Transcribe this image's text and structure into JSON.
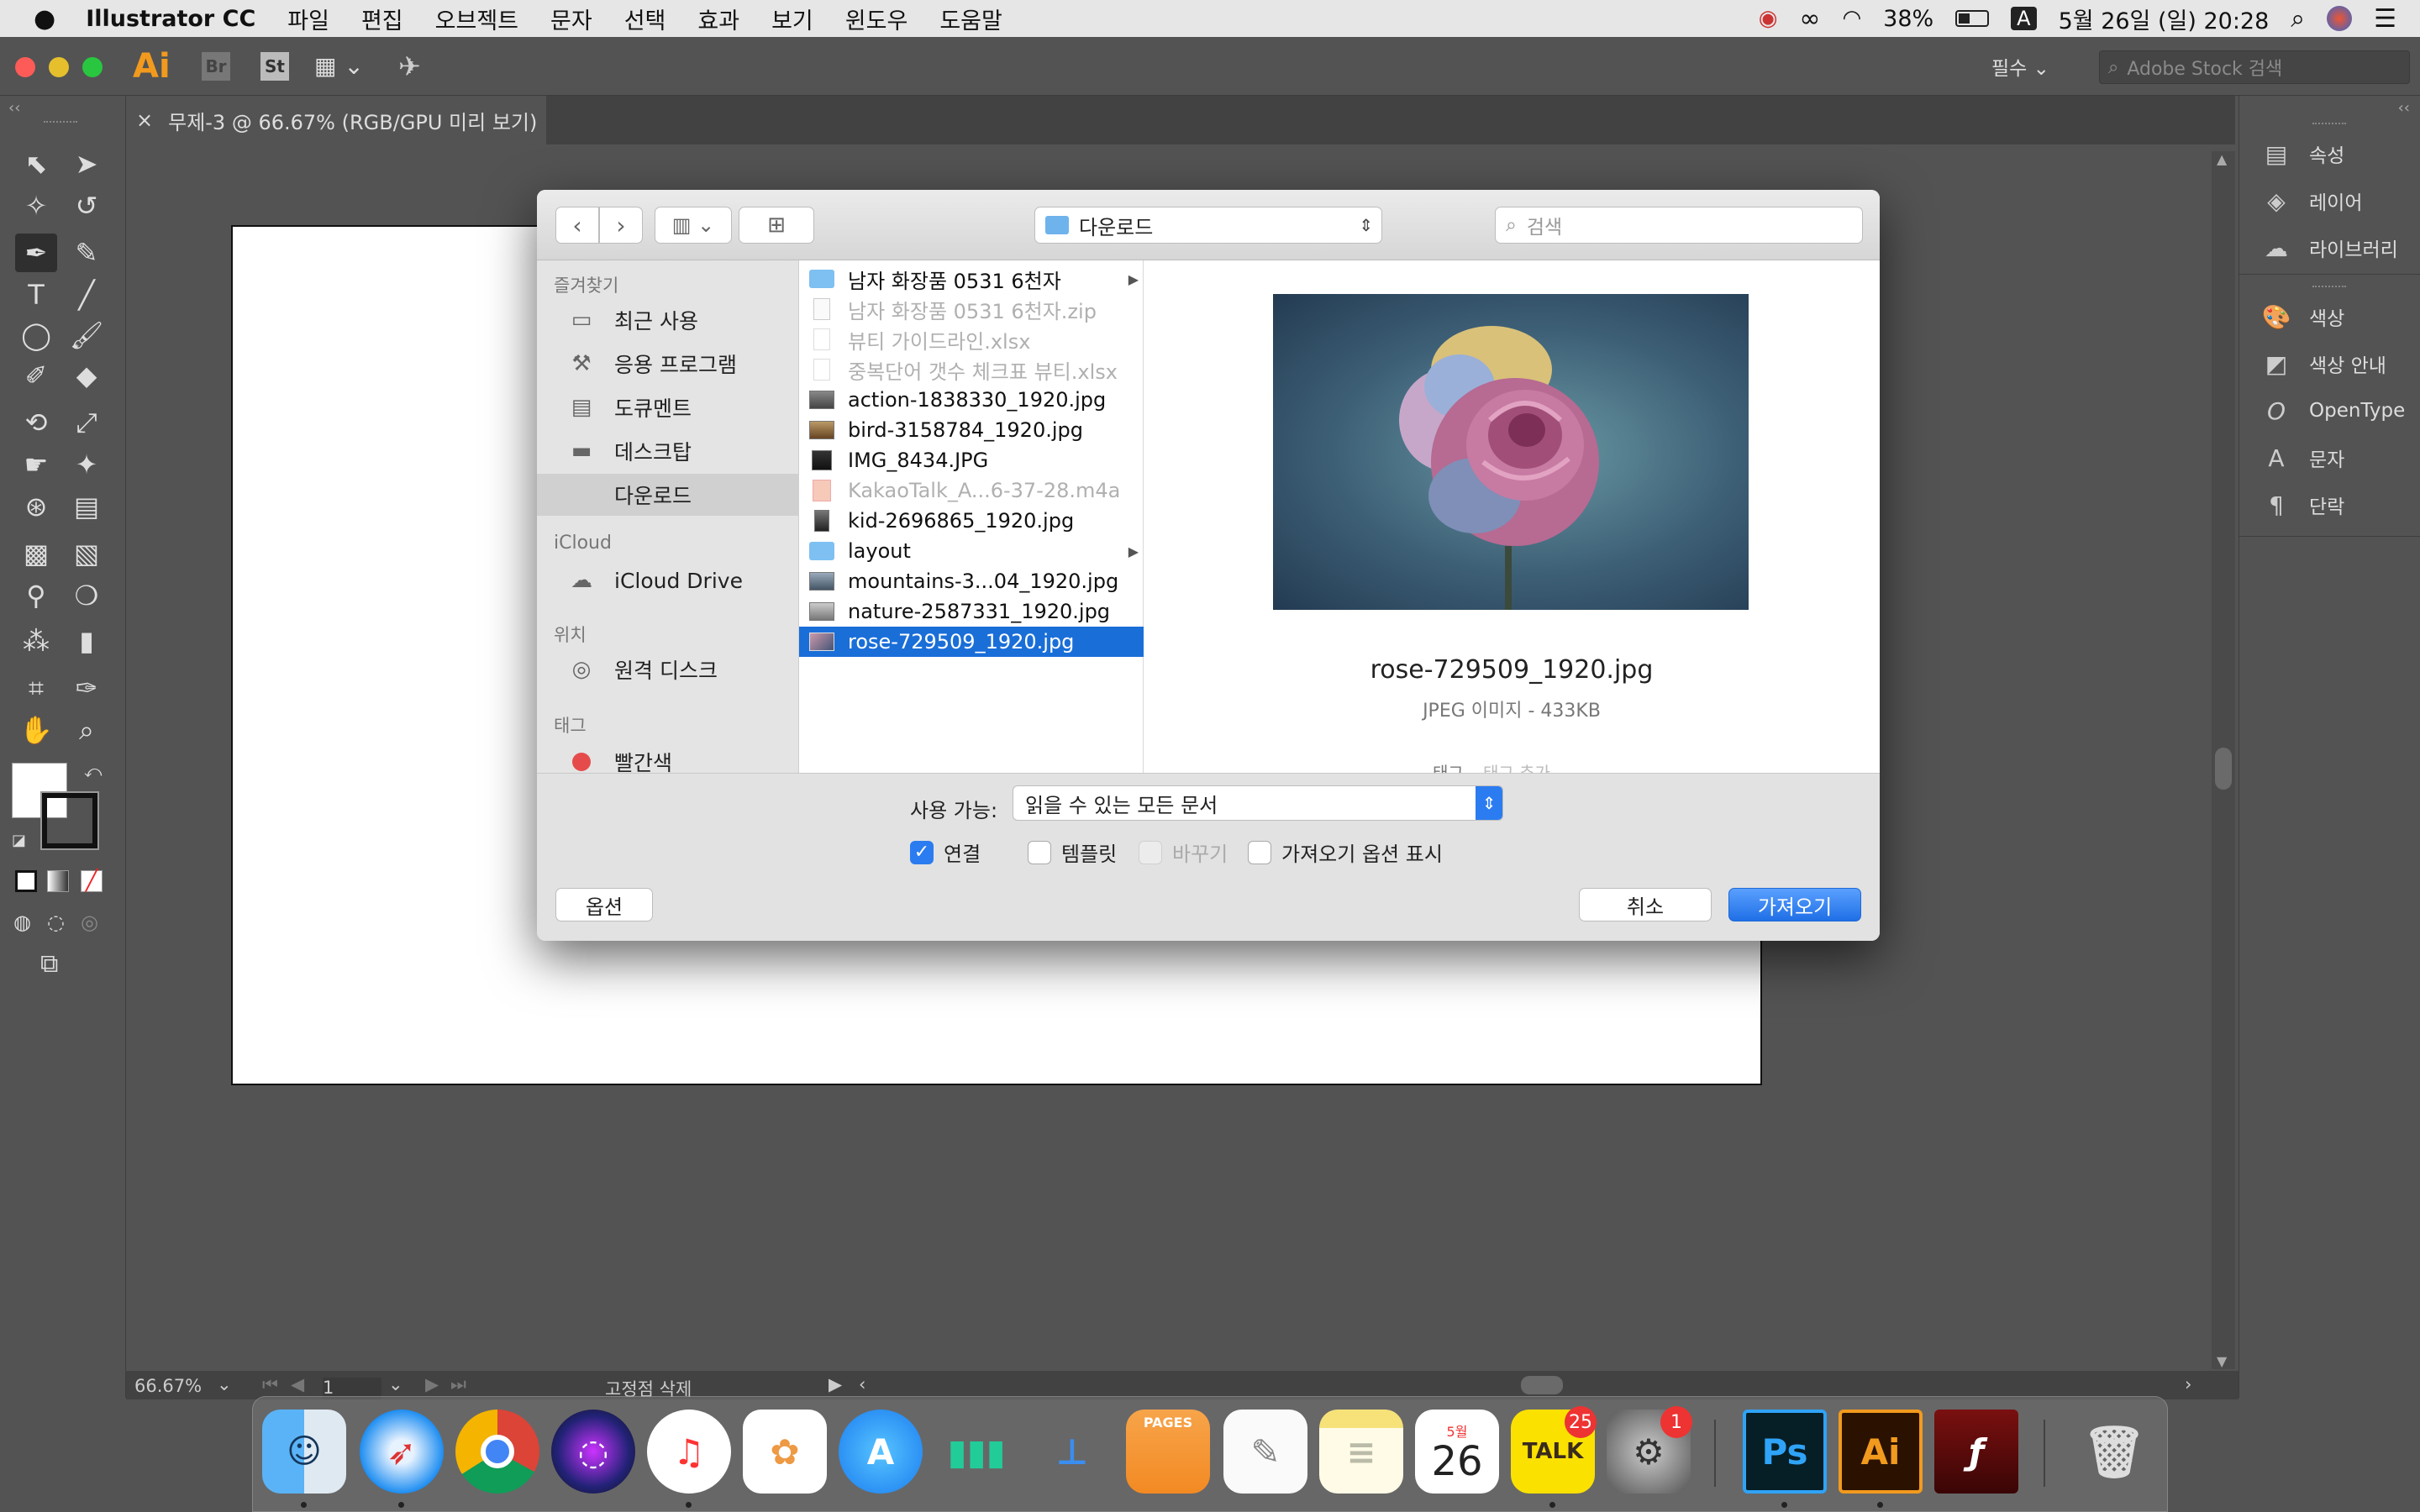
{
  "menubar": {
    "app": "Illustrator CC",
    "items": [
      "파일",
      "편집",
      "오브젝트",
      "문자",
      "선택",
      "효과",
      "보기",
      "윈도우",
      "도움말"
    ],
    "battery": "38%",
    "input_method": "A",
    "clock": "5월 26일 (일)  20:28"
  },
  "appbar": {
    "ai": "Ai",
    "br": "Br",
    "st": "St",
    "workspace": "필수",
    "stock_placeholder": "Adobe Stock 검색"
  },
  "document_tab": {
    "close": "×",
    "title": "무제-3 @ 66.67% (RGB/GPU 미리 보기)"
  },
  "right_panel": {
    "items": [
      "속성",
      "레이어",
      "라이브러리",
      "색상",
      "색상 안내",
      "OpenType",
      "문자",
      "단락"
    ]
  },
  "status": {
    "zoom": "66.67%",
    "page": "1",
    "tool": "고정점 삭제"
  },
  "dialog": {
    "location": "다운로드",
    "search_placeholder": "검색",
    "sidebar": {
      "favorites_header": "즐겨찾기",
      "favorites": [
        "최근 사용",
        "응용 프로그램",
        "도큐멘트",
        "데스크탑",
        "다운로드"
      ],
      "icloud_header": "iCloud",
      "icloud": [
        "iCloud Drive"
      ],
      "locations_header": "위치",
      "locations": [
        "원격 디스크"
      ],
      "tags_header": "태그",
      "tags": [
        "빨간색"
      ]
    },
    "files": [
      {
        "name": "남자 화장품 0531 6천자",
        "kind": "folder",
        "dim": false
      },
      {
        "name": "남자 화장품 0531 6천자.zip",
        "kind": "zip",
        "dim": true
      },
      {
        "name": "뷰티 가이드라인.xlsx",
        "kind": "doc",
        "dim": true
      },
      {
        "name": "중복단어 갯수 체크표 뷰티.xlsx",
        "kind": "doc",
        "dim": true
      },
      {
        "name": "action-1838330_1920.jpg",
        "kind": "img",
        "dim": false
      },
      {
        "name": "bird-3158784_1920.jpg",
        "kind": "img",
        "dim": false
      },
      {
        "name": "IMG_8434.JPG",
        "kind": "img",
        "dim": false
      },
      {
        "name": "KakaoTalk_A...6-37-28.m4a",
        "kind": "audio",
        "dim": true
      },
      {
        "name": "kid-2696865_1920.jpg",
        "kind": "img",
        "dim": false
      },
      {
        "name": "layout",
        "kind": "folder",
        "dim": false
      },
      {
        "name": "mountains-3...04_1920.jpg",
        "kind": "img",
        "dim": false
      },
      {
        "name": "nature-2587331_1920.jpg",
        "kind": "img",
        "dim": false
      },
      {
        "name": "rose-729509_1920.jpg",
        "kind": "img",
        "dim": false,
        "selected": true
      }
    ],
    "preview": {
      "filename": "rose-729509_1920.jpg",
      "info": "JPEG 이미지 - 433KB",
      "tags_label": "태그",
      "tags_placeholder": "태그 추가"
    },
    "enable_label": "사용 가능:",
    "enable_value": "읽을 수 있는 모든 문서",
    "checkboxes": [
      {
        "label": "연결",
        "checked": true,
        "disabled": false
      },
      {
        "label": "템플릿",
        "checked": false,
        "disabled": false
      },
      {
        "label": "바꾸기",
        "checked": false,
        "disabled": true
      },
      {
        "label": "가져오기 옵션 표시",
        "checked": false,
        "disabled": false
      }
    ],
    "options_btn": "옵션",
    "cancel_btn": "취소",
    "import_btn": "가져오기"
  },
  "dock": {
    "calendar_month": "5월",
    "calendar_day": "26",
    "talk_label": "TALK",
    "talk_badge": "25",
    "prefs_badge": "1",
    "ps": "Ps",
    "ai": "Ai",
    "pages": "PAGES"
  }
}
